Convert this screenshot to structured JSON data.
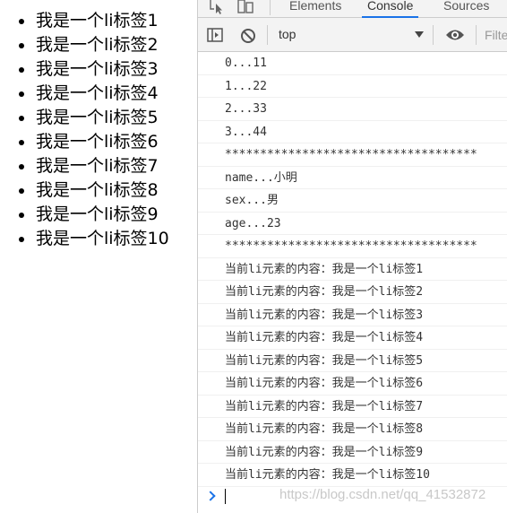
{
  "page": {
    "list_items": [
      "我是一个li标签1",
      "我是一个li标签2",
      "我是一个li标签3",
      "我是一个li标签4",
      "我是一个li标签5",
      "我是一个li标签6",
      "我是一个li标签7",
      "我是一个li标签8",
      "我是一个li标签9",
      "我是一个li标签10"
    ]
  },
  "devtools": {
    "tabs": [
      "Elements",
      "Console",
      "Sources"
    ],
    "active_tab": "Console",
    "toolbar": {
      "context": "top",
      "filter_placeholder": "Filter"
    },
    "console_lines": [
      "0...11",
      "1...22",
      "2...33",
      "3...44",
      "************************************",
      "name...小明",
      "sex...男",
      "age...23",
      "************************************",
      "当前li元素的内容：我是一个li标签1",
      "当前li元素的内容：我是一个li标签2",
      "当前li元素的内容：我是一个li标签3",
      "当前li元素的内容：我是一个li标签4",
      "当前li元素的内容：我是一个li标签5",
      "当前li元素的内容：我是一个li标签6",
      "当前li元素的内容：我是一个li标签7",
      "当前li元素的内容：我是一个li标签8",
      "当前li元素的内容：我是一个li标签9",
      "当前li元素的内容：我是一个li标签10"
    ],
    "accent_color": "#1a73e8"
  },
  "watermark": "https://blog.csdn.net/qq_41532872"
}
